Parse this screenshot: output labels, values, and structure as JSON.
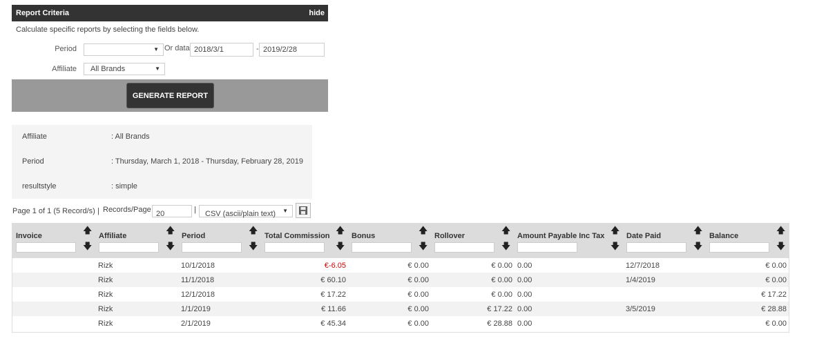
{
  "criteria": {
    "title": "Report Criteria",
    "hide_label": "hide",
    "intro": "Calculate specific reports by selecting the fields below.",
    "period_label": "Period",
    "period_value": "",
    "or_data_label": "Or data",
    "date_from": "2018/3/1",
    "date_sep": "-",
    "date_to": "2019/2/28",
    "affiliate_label": "Affiliate",
    "affiliate_value": "All Brands",
    "generate_label": "GENERATE REPORT"
  },
  "summary": {
    "rows": [
      {
        "label": "Affiliate",
        "value": ": All Brands"
      },
      {
        "label": "Period",
        "value": ": Thursday, March 1, 2018 - Thursday, February 28, 2019"
      },
      {
        "label": "resultstyle",
        "value": ": simple"
      }
    ]
  },
  "pager": {
    "page_info": "Page 1 of 1 (5 Record/s)",
    "sep1": "|",
    "records_label": "Records/Page",
    "records_value": "20",
    "sep2": "|",
    "export_value": "CSV (ascii/plain text)"
  },
  "table": {
    "columns": [
      "Invoice",
      "Affiliate",
      "Period",
      "Total Commission",
      "Bonus",
      "Rollover",
      "Amount Payable Inc Tax",
      "Date Paid",
      "Balance"
    ],
    "rows": [
      {
        "invoice": "",
        "affiliate": "Rizk",
        "period": "10/1/2018",
        "total": "€-6.05",
        "bonus": "€ 0.00",
        "rollover": "€ 0.00",
        "payable": "0.00",
        "date_paid": "12/7/2018",
        "balance": "€ 0.00"
      },
      {
        "invoice": "",
        "affiliate": "Rizk",
        "period": "11/1/2018",
        "total": "€ 60.10",
        "bonus": "€ 0.00",
        "rollover": "€ 0.00",
        "payable": "0.00",
        "date_paid": "1/4/2019",
        "balance": "€ 0.00"
      },
      {
        "invoice": "",
        "affiliate": "Rizk",
        "period": "12/1/2018",
        "total": "€ 17.22",
        "bonus": "€ 0.00",
        "rollover": "€ 0.00",
        "payable": "0.00",
        "date_paid": "",
        "balance": "€ 17.22"
      },
      {
        "invoice": "",
        "affiliate": "Rizk",
        "period": "1/1/2019",
        "total": "€ 11.66",
        "bonus": "€ 0.00",
        "rollover": "€ 17.22",
        "payable": "0.00",
        "date_paid": "3/5/2019",
        "balance": "€ 28.88"
      },
      {
        "invoice": "",
        "affiliate": "Rizk",
        "period": "2/1/2019",
        "total": "€ 45.34",
        "bonus": "€ 0.00",
        "rollover": "€ 28.88",
        "payable": "0.00",
        "date_paid": "",
        "balance": "€ 0.00"
      }
    ]
  },
  "icons": {
    "sort_up": "arrow-up-icon",
    "sort_down": "arrow-down-icon",
    "save": "floppy-disk-icon",
    "dropdown": "caret-down-icon"
  },
  "colors": {
    "header_bg": "#333333",
    "generate_bar": "#999999",
    "negative": "#d00000",
    "table_header_bg": "#dcdcdc"
  }
}
